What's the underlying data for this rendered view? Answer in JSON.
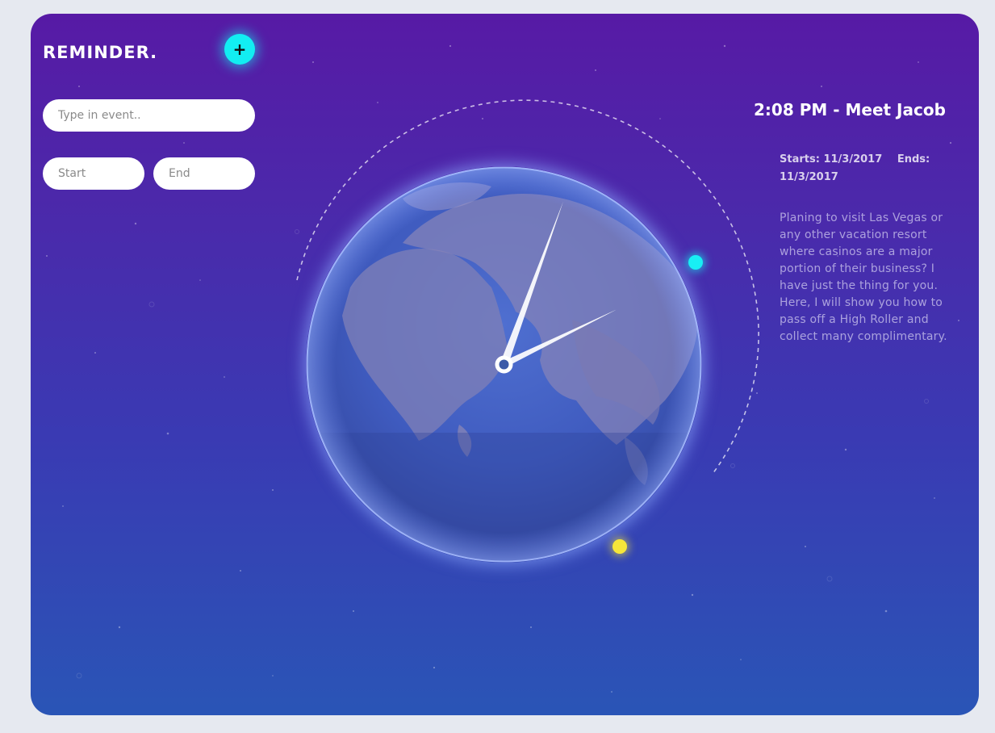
{
  "app": {
    "brand": "REMINDER.",
    "add_button_symbol": "+",
    "add_button_icon": "plus-icon"
  },
  "form": {
    "event_placeholder": "Type in event..",
    "start_placeholder": "Start",
    "end_placeholder": "End"
  },
  "event": {
    "title": "2:08 PM - Meet Jacob",
    "starts_label": "Starts:",
    "starts_value": "11/3/2017",
    "ends_label": "Ends:",
    "ends_value": "11/3/2017",
    "description": "Planing to visit Las Vegas or any other vacation resort where casinos are a major portion of their business? I have just the thing for you. Here, I will show you how to pass off a High Roller and collect many complimentary."
  },
  "clock": {
    "hour": 2,
    "minute": 8
  },
  "colors": {
    "accent_cyan": "#12eef2",
    "accent_yellow": "#f6e63a",
    "background_top": "#571aa5",
    "background_bottom": "#2a55b6"
  }
}
